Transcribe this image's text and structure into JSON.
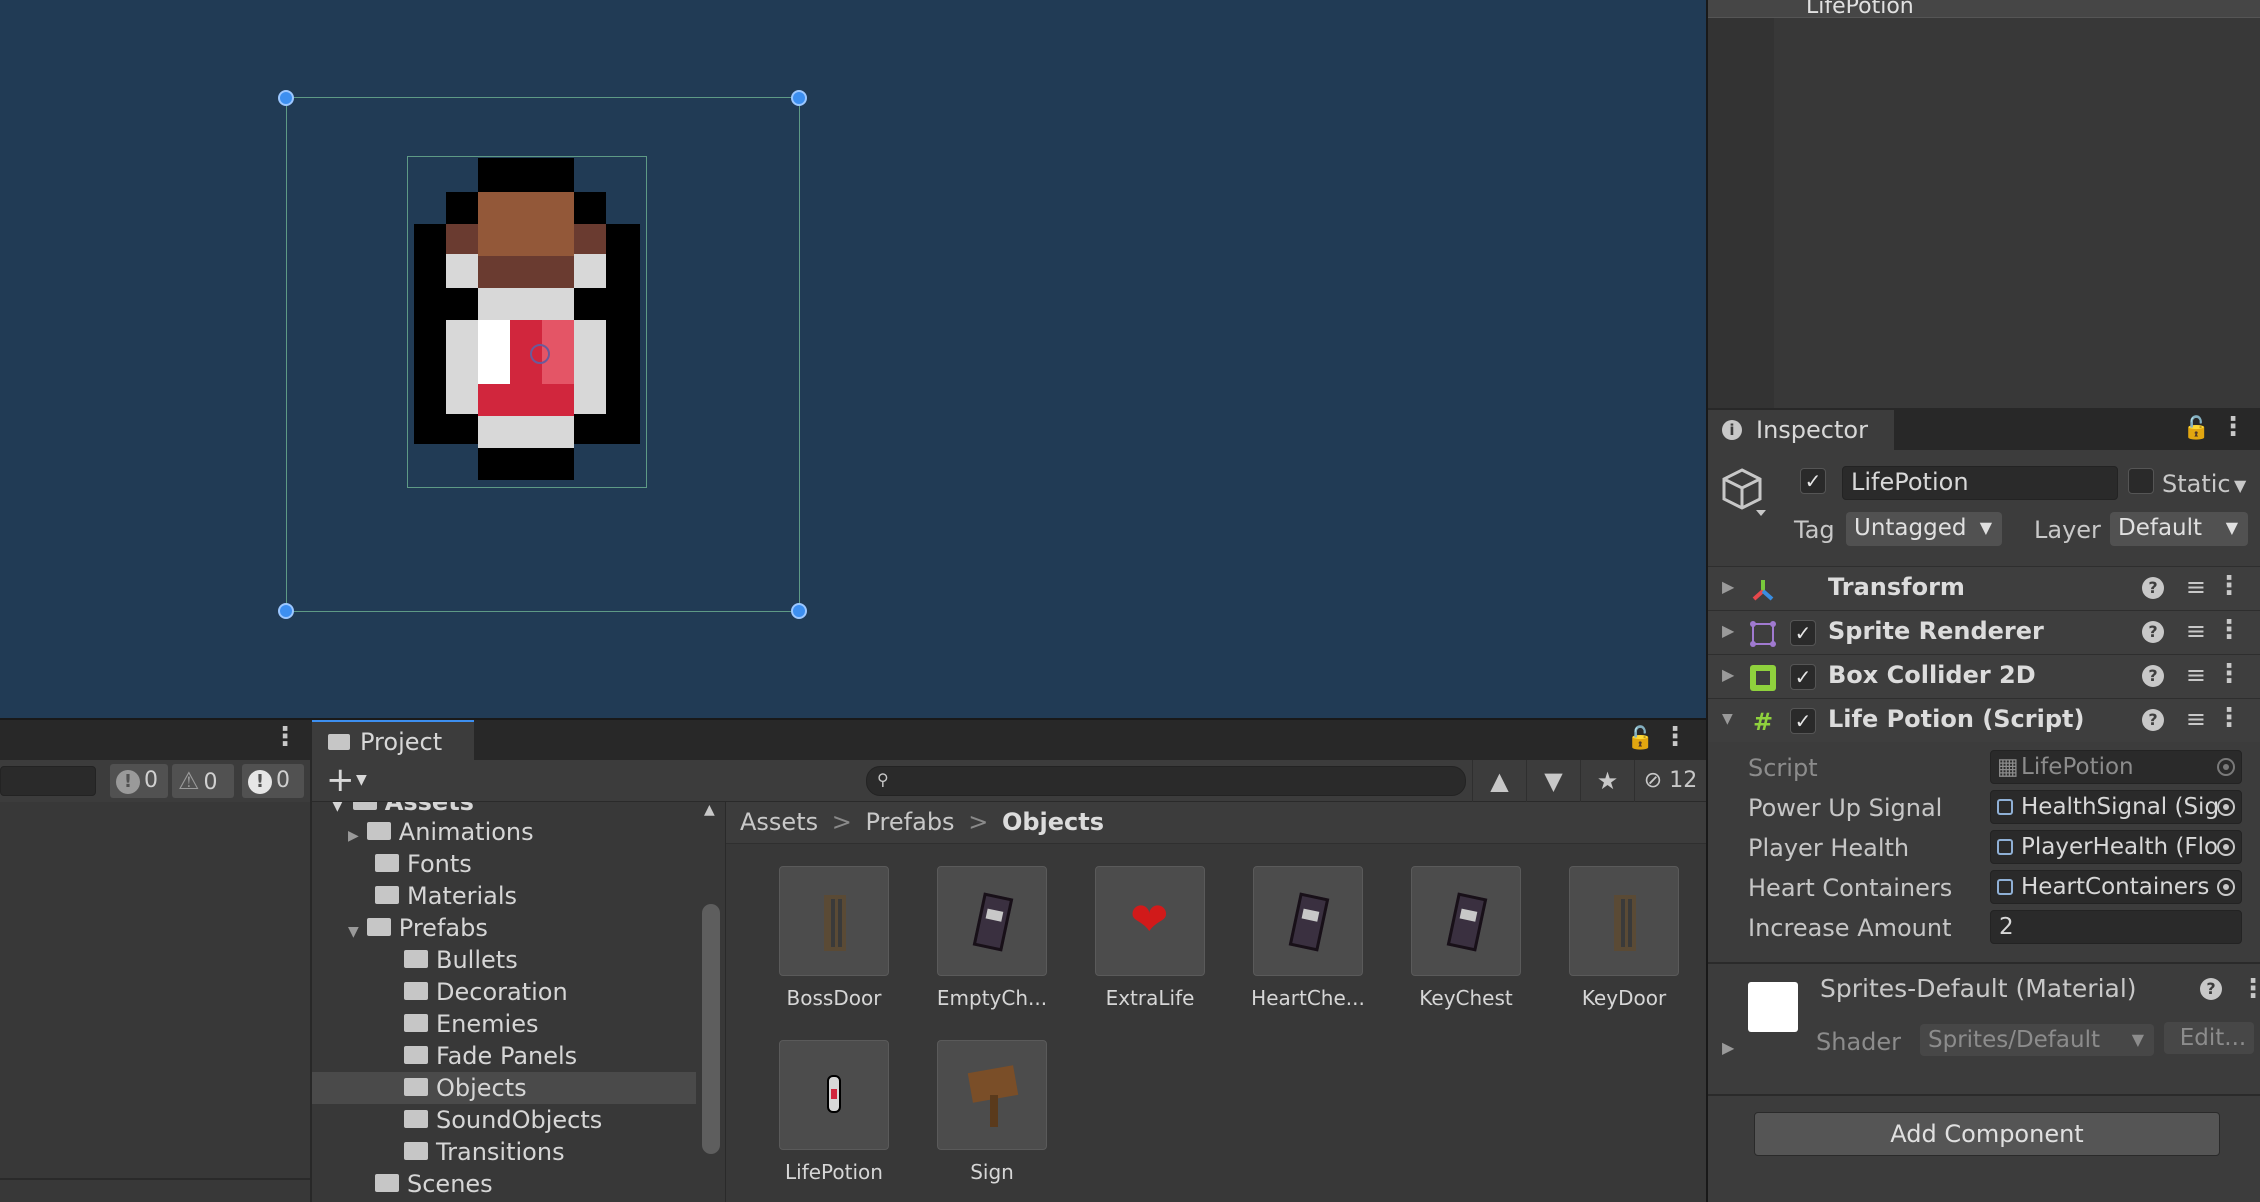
{
  "hierarchy": {
    "top_item": "LifePotion"
  },
  "console": {
    "error_count": "0",
    "warning_count": "0",
    "info_count": "0"
  },
  "project": {
    "tab": "Project",
    "add_label": "+",
    "hidden_count": "12",
    "tree": [
      "Assets",
      "Animations",
      "Fonts",
      "Materials",
      "Prefabs",
      "Bullets",
      "Decoration",
      "Enemies",
      "Fade Panels",
      "Objects",
      "SoundObjects",
      "Transitions",
      "Scenes"
    ],
    "selected_folder": "Objects",
    "breadcrumb": [
      "Assets",
      "Prefabs",
      "Objects"
    ],
    "breadcrumb_sep": ">",
    "assets": [
      "BossDoor",
      "EmptyCh...",
      "ExtraLife",
      "HeartChe...",
      "KeyChest",
      "KeyDoor",
      "LifePotion",
      "Sign"
    ]
  },
  "inspector": {
    "tab": "Inspector",
    "object_name": "LifePotion",
    "static_label": "Static",
    "tag_label": "Tag",
    "tag_value": "Untagged",
    "layer_label": "Layer",
    "layer_value": "Default",
    "components": [
      "Transform",
      "Sprite Renderer",
      "Box Collider 2D",
      "Life Potion (Script)"
    ],
    "props": [
      {
        "label": "Script",
        "value": "LifePotion"
      },
      {
        "label": "Power Up Signal",
        "value": "HealthSignal (Sig"
      },
      {
        "label": "Player Health",
        "value": "PlayerHealth (Flo"
      },
      {
        "label": "Heart Containers",
        "value": "HeartContainers"
      },
      {
        "label": "Increase Amount",
        "value": "2"
      }
    ],
    "material_name": "Sprites-Default (Material)",
    "shader_label": "Shader",
    "shader_value": "Sprites/Default",
    "edit_label": "Edit...",
    "add_component": "Add Component"
  },
  "colors": {
    "scene_bg": "#213b55",
    "panel_bg": "#3c3c3c",
    "accent": "#3d8ff0"
  }
}
